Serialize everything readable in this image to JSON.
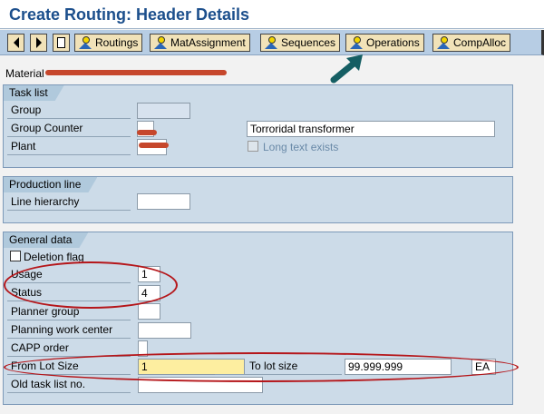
{
  "title": "Create Routing: Header Details",
  "toolbar": {
    "buttons": [
      "Routings",
      "MatAssignment",
      "Sequences",
      "Operations",
      "CompAlloc"
    ]
  },
  "material": {
    "label": "Material"
  },
  "task_list": {
    "title": "Task list",
    "group_label": "Group",
    "group_counter_label": "Group Counter",
    "plant_label": "Plant",
    "description": "Torroridal transformer",
    "long_text_label": "Long text exists"
  },
  "production_line": {
    "title": "Production line",
    "line_hierarchy_label": "Line hierarchy"
  },
  "general_data": {
    "title": "General data",
    "deletion_flag_label": "Deletion flag",
    "usage_label": "Usage",
    "usage_value": "1",
    "status_label": "Status",
    "status_value": "4",
    "planner_group_label": "Planner group",
    "planning_work_center_label": "Planning work center",
    "capp_order_label": "CAPP order",
    "from_lot_label": "From Lot Size",
    "from_lot_value": "1",
    "to_lot_label": "To lot size",
    "to_lot_value": "99.999.999",
    "unit_value": "EA",
    "old_task_list_label": "Old task list no."
  }
}
